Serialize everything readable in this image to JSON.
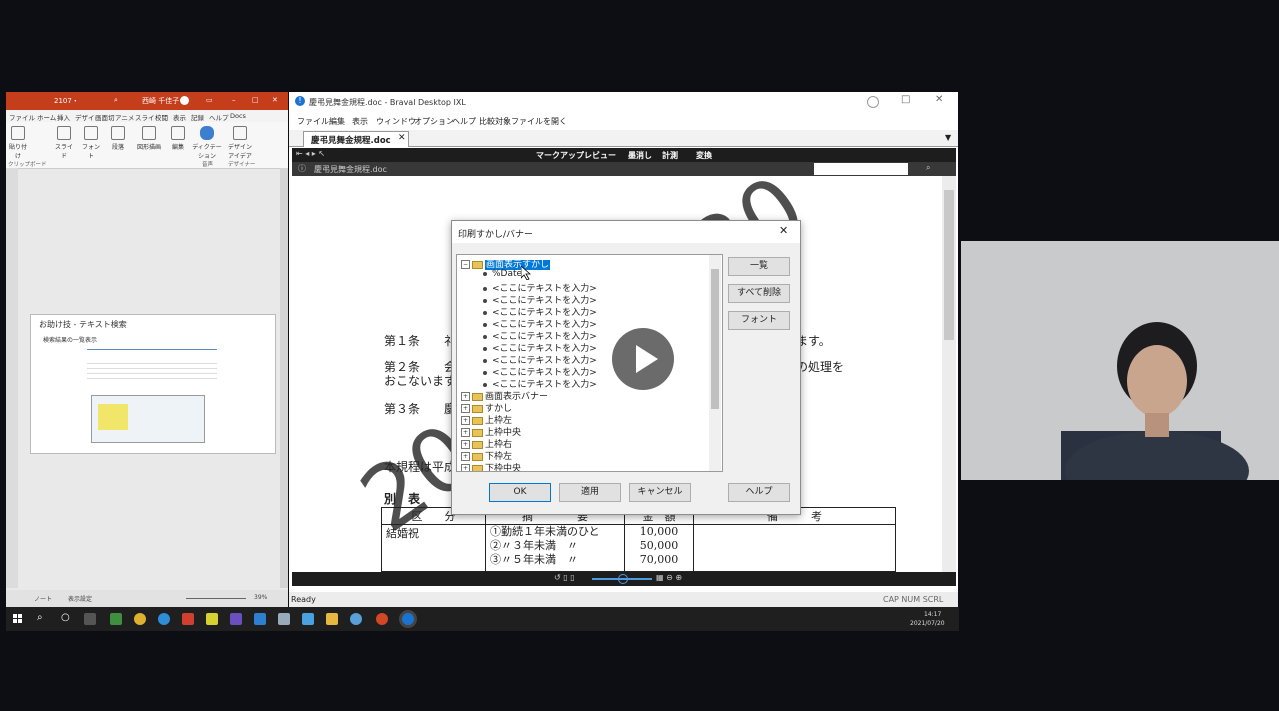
{
  "ppt": {
    "title_file": "2107・",
    "user": "西崎 千佳子",
    "tabs": [
      "ファイル",
      "ホーム",
      "挿入",
      "デザイ",
      "画面切",
      "アニメ",
      "スライ",
      "校閲",
      "表示",
      "記録",
      "ヘルプ",
      "Docs"
    ],
    "ribbon": [
      "貼り付け",
      "スライド",
      "フォント",
      "段落",
      "図形描画",
      "編集",
      "ディクテーション",
      "デザイン アイデア"
    ],
    "groups": [
      "クリップボード",
      "音声",
      "デザイナー"
    ],
    "slide_title": "お助け技 - テキスト検索",
    "slide_bullet": "検索結果の一覧表示",
    "status_notes": "ノート",
    "status_display": "表示設定",
    "zoom": "39%"
  },
  "bv": {
    "title": "慶弔見舞金規程.doc - Braval Desktop IXL",
    "menu": [
      "ファイル",
      "編集",
      "表示",
      "ウィンドウ",
      "オプション",
      "ヘルプ",
      "比較対象ファイルを開く"
    ],
    "tab": "慶弔見舞金規程.doc",
    "toolbar": [
      "マークアップ",
      "レビュー",
      "墨消し",
      "計測",
      "変換"
    ],
    "path": "慶弔見舞金規程.doc",
    "status_left": "Ready",
    "status_right": "CAP NUM SCRL"
  },
  "doc": {
    "art1": "第１条　　礻",
    "art1_end": "ます。",
    "art2": "第２条　　会",
    "art2_end": "の処理を",
    "art2_line2": "おこないます",
    "art3": "第３条　　慶",
    "note": "本規程は平成",
    "beppyo": "別　表",
    "watermark_a": "20",
    "watermark_b": "20",
    "table": {
      "headers": [
        "区　　分",
        "摘　　　　要",
        "金　額",
        "備　　　考"
      ],
      "row_cat": "結婚祝",
      "lines": [
        "①勤続１年未満のひと",
        "②〃３年未満　〃",
        "③〃５年未満　〃"
      ],
      "amounts": [
        "10,000",
        "50,000",
        "70,000"
      ]
    }
  },
  "dialog": {
    "title": "印刷すかし/バナー",
    "root": "画面表示すかし",
    "date_item": "%Date",
    "placeholder": "<ここにテキストを入力>",
    "placeholders": [
      "<ここにテキストを入力>",
      "<ここにテキストを入力>",
      "<ここにテキストを入力>",
      "<ここにテキストを入力>",
      "<ここにテキストを入力>",
      "<ここにテキストを入力>",
      "<ここにテキストを入力>",
      "<ここにテキストを入力>",
      "<ここにテキストを入力>"
    ],
    "folders": [
      "画面表示バナー",
      "すかし",
      "上枠左",
      "上枠中央",
      "上枠右",
      "下枠左",
      "下枠中央"
    ],
    "side_buttons": [
      "一覧",
      "すべて削除",
      "フォント"
    ],
    "ok": "OK",
    "apply": "適用",
    "cancel": "キャンセル",
    "help": "ヘルプ"
  },
  "taskbar": {
    "time": "14:17",
    "date": "2021/07/20"
  },
  "colors": {
    "ppt_accent": "#c43e1c",
    "selection": "#0078d7"
  }
}
